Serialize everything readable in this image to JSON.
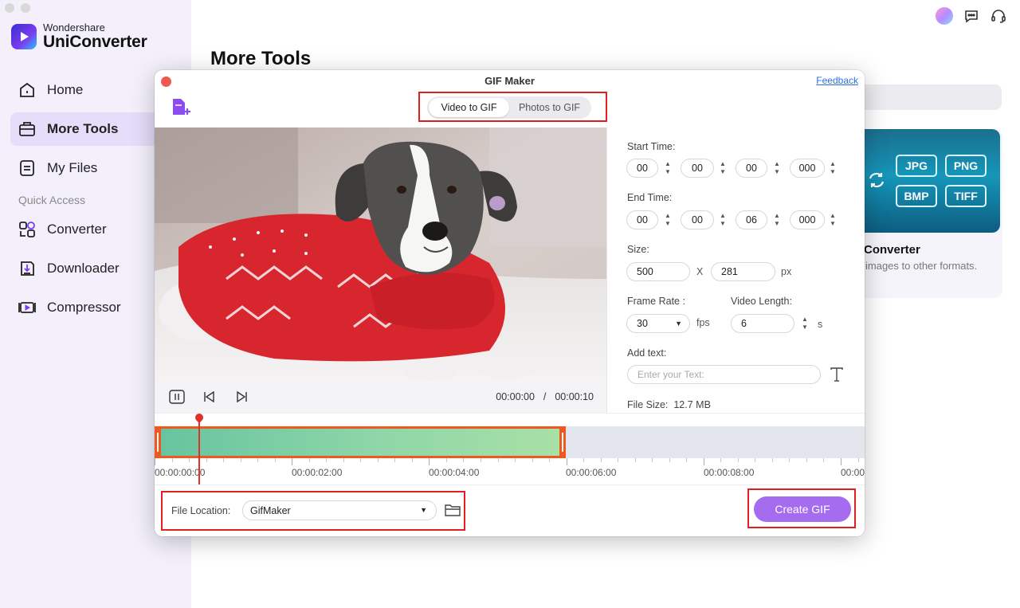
{
  "app": {
    "brand_top": "Wondershare",
    "brand_name": "UniConverter",
    "page_title": "More Tools"
  },
  "sidebar": {
    "items": [
      {
        "label": "Home",
        "icon": "home-icon",
        "active": false
      },
      {
        "label": "More Tools",
        "icon": "toolbox-icon",
        "active": true
      },
      {
        "label": "My Files",
        "icon": "file-icon",
        "active": false
      }
    ],
    "quick_access_label": "Quick Access",
    "quick_items": [
      {
        "label": "Converter",
        "icon": "converter-icon"
      },
      {
        "label": "Downloader",
        "icon": "downloader-icon"
      },
      {
        "label": "Compressor",
        "icon": "compressor-icon"
      }
    ]
  },
  "tool_card": {
    "formats": [
      "JPG",
      "PNG",
      "BMP",
      "TIFF"
    ],
    "name": "Converter",
    "description": "images to other formats."
  },
  "dialog": {
    "title": "GIF Maker",
    "feedback": "Feedback",
    "tabs": [
      {
        "label": "Video to GIF",
        "active": true
      },
      {
        "label": "Photos to GIF",
        "active": false
      }
    ],
    "player": {
      "current_time": "00:00:00",
      "separator": "/",
      "total_time": "00:00:10"
    },
    "settings": {
      "start_time_label": "Start Time:",
      "start_time": [
        "00",
        "00",
        "00",
        "000"
      ],
      "end_time_label": "End Time:",
      "end_time": [
        "00",
        "00",
        "06",
        "000"
      ],
      "size_label": "Size:",
      "width": "500",
      "x": "X",
      "height": "281",
      "px": "px",
      "frame_rate_label": "Frame Rate :",
      "frame_rate": "30",
      "fps": "fps",
      "video_length_label": "Video Length:",
      "video_length": "6",
      "seconds": "s",
      "add_text_label": "Add text:",
      "text_placeholder": "Enter your Text:",
      "file_size_label": "File Size:",
      "file_size": "12.7 MB"
    },
    "timeline": {
      "labels": [
        "00:00:00:00",
        "00:00:02:00",
        "00:00:04:00",
        "00:00:06:00",
        "00:00:08:00",
        "00:00"
      ],
      "selection_end_seconds": 6
    },
    "bottom": {
      "file_location_label": "File Location:",
      "file_location": "GifMaker",
      "create_label": "Create GIF"
    }
  },
  "colors": {
    "accent": "#a56cf0",
    "highlight": "#e02020",
    "clip_border": "#f0581f"
  }
}
